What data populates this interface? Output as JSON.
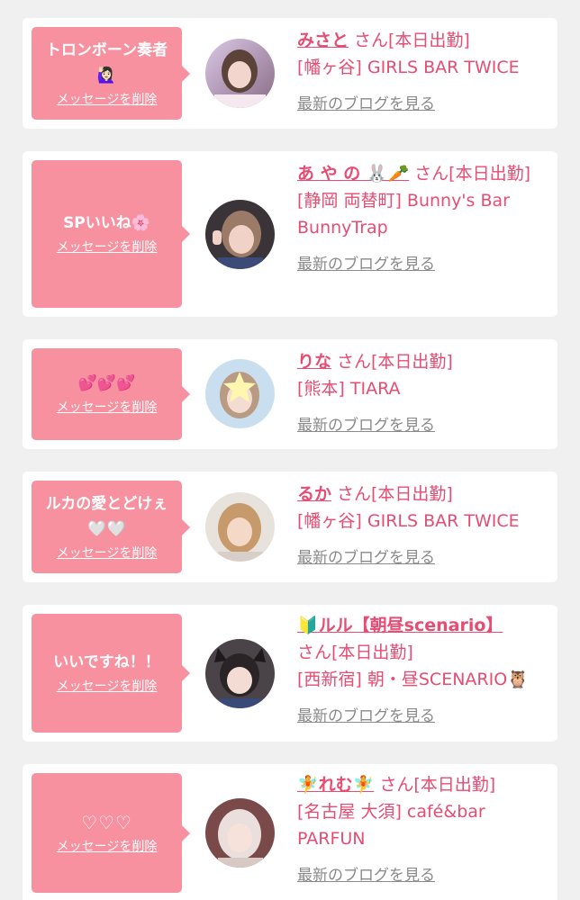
{
  "common": {
    "delete_label": "メッセージを削除",
    "blog_label": "最新のブログを見る"
  },
  "cards": [
    {
      "message_line1": "トロンボーン奏者",
      "message_line2": "🙋🏻‍♀️",
      "name": "みさと",
      "suffix": "さん[本日出勤]",
      "shop": "[幡ヶ谷] GIRLS BAR TWICE"
    },
    {
      "message_line1": "SPいいね🌸",
      "name": "あ や の 🐰🥕",
      "suffix": "さん[本日出勤]",
      "shop": "[静岡 両替町] Bunny's Bar BunnyTrap"
    },
    {
      "message_line1": "💕💕💕",
      "name": "りな",
      "suffix": "さん[本日出勤]",
      "shop": "[熊本] TIARA"
    },
    {
      "message_line1": "ルカの愛とどけぇ",
      "message_line2": "🤍🤍",
      "name": "るか",
      "suffix": "さん[本日出勤]",
      "shop": "[幡ヶ谷] GIRLS BAR TWICE"
    },
    {
      "message_line1": "いいですね！！",
      "name": "🔰ルル【朝昼scenario】",
      "suffix": "さん[本日出勤]",
      "shop": "[西新宿] 朝・昼SCENARIO🦉"
    },
    {
      "message_line1": "♡♡♡",
      "name": "🧚れむ🧚",
      "suffix": "さん[本日出勤]",
      "shop": "[名古屋 大須] café&bar PARFUN"
    }
  ]
}
